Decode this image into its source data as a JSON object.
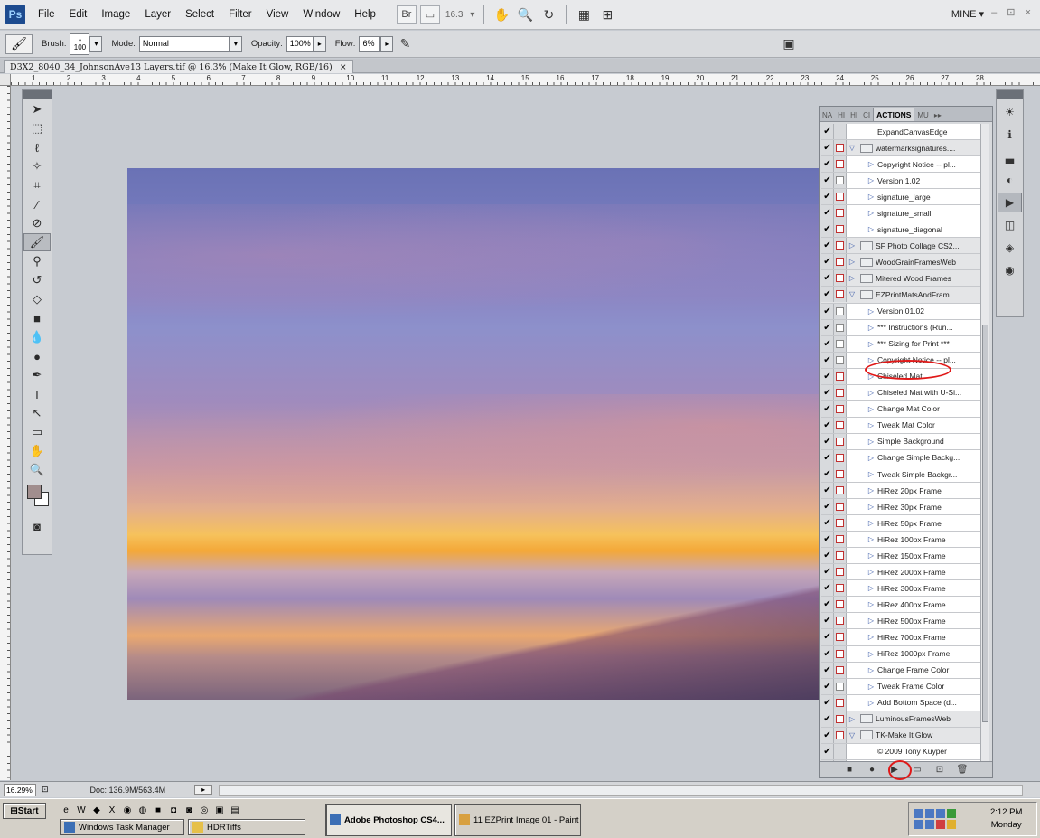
{
  "app": {
    "logo": "Ps",
    "menu": [
      "File",
      "Edit",
      "Image",
      "Layer",
      "Select",
      "Filter",
      "View",
      "Window",
      "Help"
    ],
    "menubar_zoom": "16.3",
    "workspace": "MINE",
    "window_controls": "– ⊡ ×"
  },
  "options": {
    "brush_label": "Brush:",
    "brush_size": "100",
    "mode_label": "Mode:",
    "mode_value": "Normal",
    "opacity_label": "Opacity:",
    "opacity_value": "100%",
    "flow_label": "Flow:",
    "flow_value": "6%"
  },
  "document": {
    "tab_title": "D3X2_8040_34_JohnsonAve13 Layers.tif @ 16.3% (Make It Glow, RGB/16)",
    "tab_close": "×"
  },
  "ruler_numbers": [
    "1",
    "2",
    "3",
    "4",
    "5",
    "6",
    "7",
    "8",
    "9",
    "10",
    "11",
    "12",
    "13",
    "14",
    "15",
    "16",
    "17",
    "18",
    "19",
    "20",
    "21",
    "22",
    "23",
    "24",
    "25",
    "26",
    "27",
    "28"
  ],
  "actions_panel": {
    "tabs": [
      "NA",
      "HI",
      "HI",
      "CI",
      "ACTIONS",
      "MU"
    ],
    "active_tab": "ACTIONS",
    "rows": [
      {
        "label": "ExpandCanvasEdge",
        "kind": "item",
        "dialog": "none"
      },
      {
        "label": "watermarksignatures....",
        "kind": "set-open",
        "dialog": "red"
      },
      {
        "label": "Copyright Notice -- pl...",
        "kind": "item",
        "dialog": "red"
      },
      {
        "label": "Version 1.02",
        "kind": "item",
        "dialog": "gray"
      },
      {
        "label": "signature_large",
        "kind": "item",
        "dialog": "red"
      },
      {
        "label": "signature_small",
        "kind": "item",
        "dialog": "red"
      },
      {
        "label": "signature_diagonal",
        "kind": "item",
        "dialog": "red"
      },
      {
        "label": "SF Photo Collage CS2...",
        "kind": "set",
        "dialog": "red"
      },
      {
        "label": "WoodGrainFramesWeb",
        "kind": "set",
        "dialog": "red"
      },
      {
        "label": "Mitered Wood Frames",
        "kind": "set",
        "dialog": "red"
      },
      {
        "label": "EZPrintMatsAndFram...",
        "kind": "set-open",
        "dialog": "red"
      },
      {
        "label": "Version 01.02",
        "kind": "item",
        "dialog": "gray"
      },
      {
        "label": "*** Instructions (Run...",
        "kind": "item",
        "dialog": "gray"
      },
      {
        "label": "*** Sizing for Print ***",
        "kind": "item",
        "dialog": "gray"
      },
      {
        "label": "Copyright Notice -- pl...",
        "kind": "item",
        "dialog": "gray"
      },
      {
        "label": "Chiseled Mat",
        "kind": "item",
        "dialog": "red"
      },
      {
        "label": "Chiseled Mat with U-Si...",
        "kind": "item",
        "dialog": "red"
      },
      {
        "label": "Change Mat Color",
        "kind": "item",
        "dialog": "red"
      },
      {
        "label": "Tweak Mat Color",
        "kind": "item",
        "dialog": "red"
      },
      {
        "label": "Simple Background",
        "kind": "item",
        "dialog": "red"
      },
      {
        "label": "Change Simple Backg...",
        "kind": "item",
        "dialog": "red"
      },
      {
        "label": "Tweak Simple Backgr...",
        "kind": "item",
        "dialog": "red"
      },
      {
        "label": "HiRez 20px Frame",
        "kind": "item",
        "dialog": "red"
      },
      {
        "label": "HiRez 30px Frame",
        "kind": "item",
        "dialog": "red"
      },
      {
        "label": "HiRez 50px Frame",
        "kind": "item",
        "dialog": "red"
      },
      {
        "label": "HiRez 100px Frame",
        "kind": "item",
        "dialog": "red"
      },
      {
        "label": "HiRez 150px Frame",
        "kind": "item",
        "dialog": "red"
      },
      {
        "label": "HiRez 200px Frame",
        "kind": "item",
        "dialog": "red"
      },
      {
        "label": "HiRez 300px Frame",
        "kind": "item",
        "dialog": "red"
      },
      {
        "label": "HiRez 400px Frame",
        "kind": "item",
        "dialog": "red"
      },
      {
        "label": "HiRez 500px Frame",
        "kind": "item",
        "dialog": "red"
      },
      {
        "label": "HiRez 700px Frame",
        "kind": "item",
        "dialog": "red"
      },
      {
        "label": "HiRez 1000px Frame",
        "kind": "item",
        "dialog": "red"
      },
      {
        "label": "Change Frame Color",
        "kind": "item",
        "dialog": "red"
      },
      {
        "label": "Tweak Frame Color",
        "kind": "item",
        "dialog": "gray"
      },
      {
        "label": "Add Bottom Space (d...",
        "kind": "item",
        "dialog": "red"
      },
      {
        "label": "LuminousFramesWeb",
        "kind": "set",
        "dialog": "red"
      },
      {
        "label": "TK-Make It Glow",
        "kind": "set-open",
        "dialog": "red"
      },
      {
        "label": "© 2009 Tony Kuyper",
        "kind": "item",
        "dialog": "none"
      },
      {
        "label": "TK-Make It Glow",
        "kind": "item-selected",
        "dialog": "red"
      }
    ]
  },
  "status": {
    "zoom": "16.29%",
    "doc_size": "Doc: 136.9M/563.4M"
  },
  "taskbar": {
    "start": "Start",
    "tasks": [
      "Windows Task Manager",
      "HDRTiffs",
      "Adobe Photoshop CS4...",
      "11 EZPrint Image 01 - Paint"
    ],
    "time": "2:12 PM",
    "day": "Monday"
  },
  "colors": {
    "foreground": "#a18e8e",
    "background": "#ffffff",
    "highlight_circle": "#e01818"
  }
}
